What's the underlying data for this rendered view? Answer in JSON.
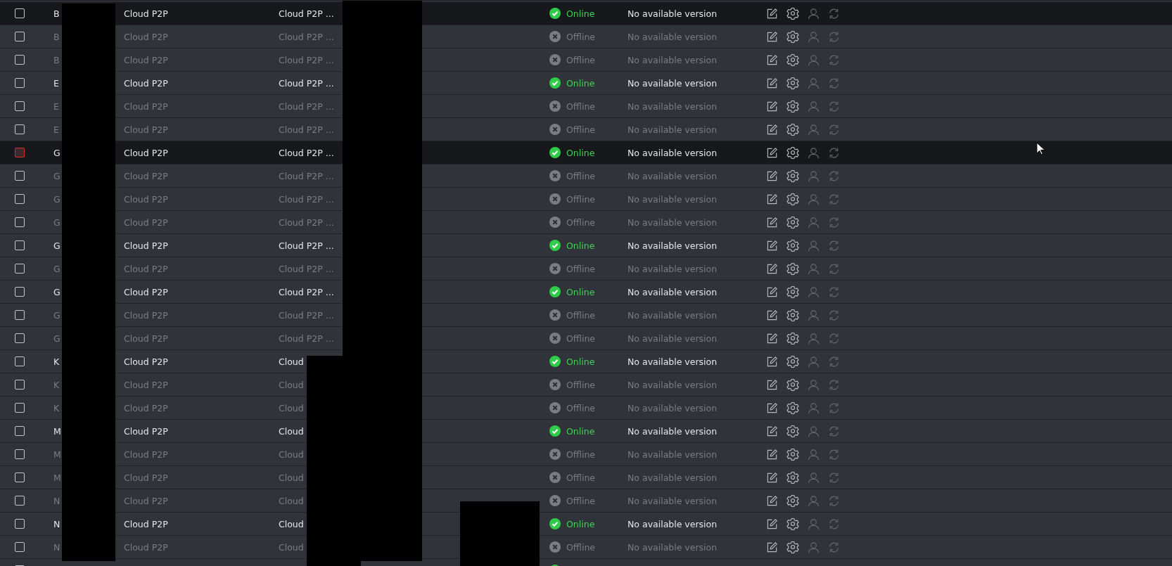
{
  "actions": [
    {
      "kind": "edit",
      "disabled": false
    },
    {
      "kind": "settings",
      "disabled": false
    },
    {
      "kind": "user",
      "disabled": true
    },
    {
      "kind": "refresh",
      "disabled": true
    }
  ],
  "rows": [
    {
      "name": "B",
      "type": "Cloud P2P",
      "column_4": "Cloud P2P ...",
      "online": true,
      "status_text": "Online",
      "version": "No available version",
      "checked": false,
      "focused": false,
      "highlighted": true
    },
    {
      "name": "B",
      "type": "Cloud P2P",
      "column_4": "Cloud P2P ...",
      "online": false,
      "status_text": "Offline",
      "version": "No available version",
      "checked": false,
      "focused": false,
      "highlighted": false
    },
    {
      "name": "B",
      "type": "Cloud P2P",
      "column_4": "Cloud P2P ...",
      "online": false,
      "status_text": "Offline",
      "version": "No available version",
      "checked": false,
      "focused": false,
      "highlighted": false
    },
    {
      "name": "E",
      "type": "Cloud P2P",
      "column_4": "Cloud P2P ...",
      "online": true,
      "status_text": "Online",
      "version": "No available version",
      "checked": false,
      "focused": false,
      "highlighted": false
    },
    {
      "name": "E",
      "type": "Cloud P2P",
      "column_4": "Cloud P2P ...",
      "online": false,
      "status_text": "Offline",
      "version": "No available version",
      "checked": false,
      "focused": false,
      "highlighted": false
    },
    {
      "name": "E",
      "type": "Cloud P2P",
      "column_4": "Cloud P2P ...",
      "online": false,
      "status_text": "Offline",
      "version": "No available version",
      "checked": false,
      "focused": false,
      "highlighted": false
    },
    {
      "name": "G",
      "type": "Cloud P2P",
      "column_4": "Cloud P2P ...",
      "online": true,
      "status_text": "Online",
      "version": "No available version",
      "checked": false,
      "focused": true,
      "highlighted": true
    },
    {
      "name": "G",
      "type": "Cloud P2P",
      "column_4": "Cloud P2P ...",
      "online": false,
      "status_text": "Offline",
      "version": "No available version",
      "checked": false,
      "focused": false,
      "highlighted": false
    },
    {
      "name": "G",
      "type": "Cloud P2P",
      "column_4": "Cloud P2P ...",
      "online": false,
      "status_text": "Offline",
      "version": "No available version",
      "checked": false,
      "focused": false,
      "highlighted": false
    },
    {
      "name": "G",
      "type": "Cloud P2P",
      "column_4": "Cloud P2P ...",
      "online": false,
      "status_text": "Offline",
      "version": "No available version",
      "checked": false,
      "focused": false,
      "highlighted": false
    },
    {
      "name": "G",
      "type": "Cloud P2P",
      "column_4": "Cloud P2P ...",
      "online": true,
      "status_text": "Online",
      "version": "No available version",
      "checked": false,
      "focused": false,
      "highlighted": false
    },
    {
      "name": "G",
      "type": "Cloud P2P",
      "column_4": "Cloud P2P ...",
      "online": false,
      "status_text": "Offline",
      "version": "No available version",
      "checked": false,
      "focused": false,
      "highlighted": false
    },
    {
      "name": "G",
      "type": "Cloud P2P",
      "column_4": "Cloud P2P ...",
      "online": true,
      "status_text": "Online",
      "version": "No available version",
      "checked": false,
      "focused": false,
      "highlighted": false
    },
    {
      "name": "G",
      "type": "Cloud P2P",
      "column_4": "Cloud P2P ...",
      "online": false,
      "status_text": "Offline",
      "version": "No available version",
      "checked": false,
      "focused": false,
      "highlighted": false
    },
    {
      "name": "G",
      "type": "Cloud P2P",
      "column_4": "Cloud P2P ...",
      "online": false,
      "status_text": "Offline",
      "version": "No available version",
      "checked": false,
      "focused": false,
      "highlighted": false
    },
    {
      "name": "K",
      "type": "Cloud P2P",
      "column_4": "Cloud",
      "online": true,
      "status_text": "Online",
      "version": "No available version",
      "checked": false,
      "focused": false,
      "highlighted": false
    },
    {
      "name": "K",
      "type": "Cloud P2P",
      "column_4": "Cloud",
      "online": false,
      "status_text": "Offline",
      "version": "No available version",
      "checked": false,
      "focused": false,
      "highlighted": false
    },
    {
      "name": "K",
      "type": "Cloud P2P",
      "column_4": "Cloud",
      "online": false,
      "status_text": "Offline",
      "version": "No available version",
      "checked": false,
      "focused": false,
      "highlighted": false
    },
    {
      "name": "M",
      "type": "Cloud P2P",
      "column_4": "Cloud",
      "online": true,
      "status_text": "Online",
      "version": "No available version",
      "checked": false,
      "focused": false,
      "highlighted": false
    },
    {
      "name": "M",
      "type": "Cloud P2P",
      "column_4": "Cloud",
      "online": false,
      "status_text": "Offline",
      "version": "No available version",
      "checked": false,
      "focused": false,
      "highlighted": false
    },
    {
      "name": "M",
      "type": "Cloud P2P",
      "column_4": "Cloud",
      "online": false,
      "status_text": "Offline",
      "version": "No available version",
      "checked": false,
      "focused": false,
      "highlighted": false
    },
    {
      "name": "N",
      "type": "Cloud P2P",
      "column_4": "Cloud",
      "online": false,
      "status_text": "Offline",
      "version": "No available version",
      "checked": false,
      "focused": false,
      "highlighted": false
    },
    {
      "name": "N",
      "type": "Cloud P2P",
      "column_4": "Cloud",
      "online": true,
      "status_text": "Online",
      "version": "No available version",
      "checked": false,
      "focused": false,
      "highlighted": false
    },
    {
      "name": "N",
      "type": "Cloud P2P",
      "column_4": "Cloud",
      "online": false,
      "status_text": "Offline",
      "version": "No available version",
      "checked": false,
      "focused": false,
      "highlighted": false
    },
    {
      "online": true,
      "checked": false,
      "focused": false,
      "highlighted": false
    }
  ]
}
